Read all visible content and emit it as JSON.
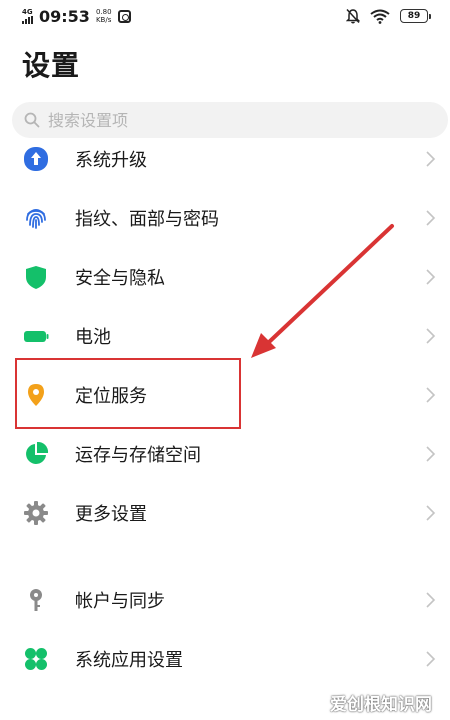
{
  "status_bar": {
    "network_type": "4G",
    "time": "09:53",
    "speed_value": "0.80",
    "speed_unit": "KB/s",
    "battery": "89"
  },
  "header": {
    "title": "设置"
  },
  "search": {
    "placeholder": "搜索设置项"
  },
  "settings": {
    "items": [
      {
        "label": "系统升级",
        "icon": "system-update-icon",
        "color": "#2f6de1"
      },
      {
        "label": "指纹、面部与密码",
        "icon": "fingerprint-icon",
        "color": "#2f6de1"
      },
      {
        "label": "安全与隐私",
        "icon": "shield-icon",
        "color": "#14c06a"
      },
      {
        "label": "电池",
        "icon": "battery-icon",
        "color": "#14c06a"
      },
      {
        "label": "定位服务",
        "icon": "location-pin-icon",
        "color": "#f3a11a"
      },
      {
        "label": "运存与存储空间",
        "icon": "storage-pie-icon",
        "color": "#14c06a"
      },
      {
        "label": "更多设置",
        "icon": "gear-icon",
        "color": "#8a8a8a"
      },
      {
        "label": "帐户与同步",
        "icon": "key-icon",
        "color": "#8a8a8a"
      },
      {
        "label": "系统应用设置",
        "icon": "apps-grid-icon",
        "color": "#14c06a"
      }
    ]
  },
  "annotation": {
    "highlight_color": "#d93434"
  },
  "watermark": {
    "text": "爱创根知识网"
  }
}
